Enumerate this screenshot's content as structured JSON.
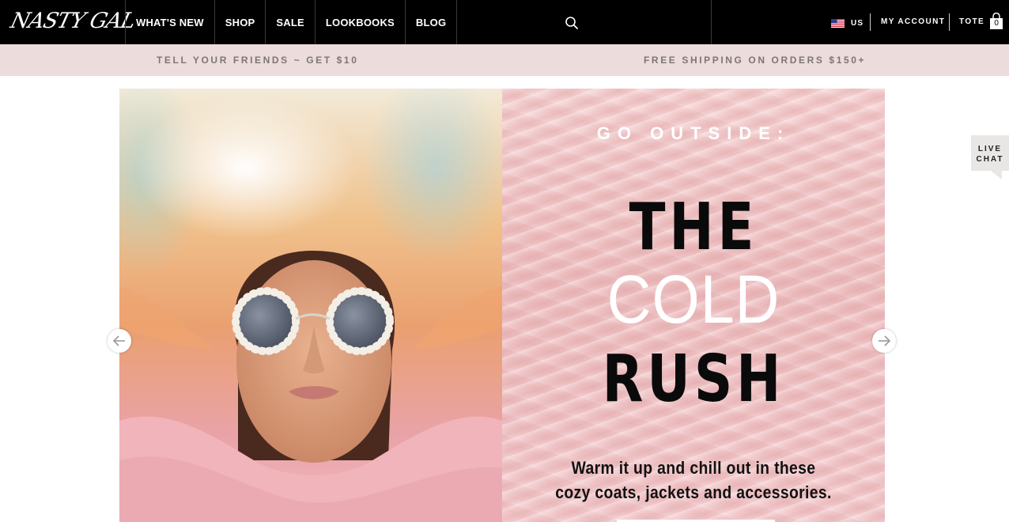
{
  "header": {
    "logo_text": "NASTY GAL",
    "nav": [
      {
        "label": "WHAT'S NEW"
      },
      {
        "label": "SHOP"
      },
      {
        "label": "SALE"
      },
      {
        "label": "LOOKBOOKS"
      },
      {
        "label": "BLOG"
      }
    ],
    "search_icon": "search-icon",
    "region_label": "US",
    "region_flag": "us-flag-icon",
    "account_label": "MY ACCOUNT",
    "tote_label": "TOTE",
    "tote_count": "0",
    "tote_icon": "shopping-bag-icon"
  },
  "promo": {
    "left": "TELL YOUR FRIENDS ~ GET $10",
    "right": "FREE SHIPPING ON ORDERS $150+"
  },
  "hero": {
    "kicker": "GO OUTSIDE:",
    "headline": [
      "THE",
      "COLD",
      "RUSH"
    ],
    "body": [
      "Warm it up and chill out in these",
      "cozy coats, jackets and accessories."
    ],
    "prev_icon": "arrow-left-icon",
    "next_icon": "arrow-right-icon"
  },
  "live_chat": {
    "line1": "LIVE",
    "line2": "CHAT"
  },
  "colors": {
    "header_bg": "#000000",
    "promo_bg": "#eddcdc",
    "promo_text": "#7d7672",
    "panel_pink": "#f0c6c8",
    "headline_dark": "#0a0a0a",
    "headline_light": "#ffffff"
  }
}
